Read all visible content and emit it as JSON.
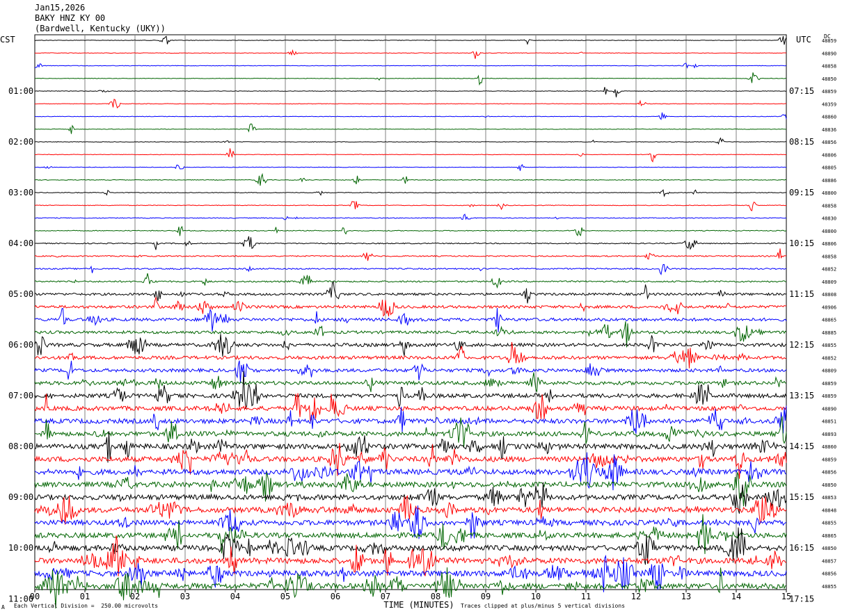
{
  "header": {
    "date": "Jan15,2026",
    "station": "BAKY HNZ KY 00",
    "location": "(Bardwell, Kentucky (UKY))"
  },
  "left_zone": "CST",
  "right_zone": "UTC",
  "dc_label": "DC",
  "footer": {
    "scale_note": "Each Vertical Division =  250.00 microvolts",
    "clip_note": "Traces clipped at plus/minus 5 vertical divisions",
    "corner_mark": "A"
  },
  "colors": {
    "trace_cycle": [
      "#000000",
      "#ff0000",
      "#0000ff",
      "#006400"
    ],
    "grid": "#808080"
  },
  "chart_data": {
    "type": "line",
    "title": "BAKY HNZ KY 00",
    "xlabel": "TIME (MINUTES)",
    "ylabel": "",
    "x_ticks": [
      "00",
      "01",
      "02",
      "03",
      "04",
      "05",
      "06",
      "07",
      "08",
      "09",
      "10",
      "11",
      "12",
      "13",
      "14",
      "15"
    ],
    "xlim": [
      0,
      15
    ],
    "left_hour_labels": [
      "01:00",
      "02:00",
      "03:00",
      "04:00",
      "05:00",
      "06:00",
      "07:00",
      "08:00",
      "09:00",
      "10:00",
      "11:00"
    ],
    "right_hour_labels": [
      "07:15",
      "08:15",
      "09:15",
      "10:15",
      "11:15",
      "12:15",
      "13:15",
      "14:15",
      "15:15",
      "16:15",
      "17:15"
    ],
    "dc_offsets": [
      "48859",
      "48890",
      "48858",
      "48850",
      "48859",
      "48359",
      "48860",
      "48836",
      "48856",
      "48806",
      "48805",
      "48886",
      "48800",
      "48858",
      "48830",
      "48800",
      "48806",
      "48858",
      "48852",
      "48809",
      "48808",
      "48906",
      "48865",
      "48885",
      "48855",
      "48852",
      "48809",
      "48859",
      "48859",
      "48890",
      "48851",
      "48893",
      "48860",
      "48859",
      "48856",
      "48850",
      "48853",
      "48848",
      "48855",
      "48865",
      "48850",
      "48857",
      "48856",
      "48855"
    ],
    "grid": true,
    "series": [
      {
        "values": [
          0.04,
          0.1
        ]
      },
      {
        "values": [
          0.04,
          0.1
        ]
      },
      {
        "values": [
          0.04,
          0.1
        ]
      },
      {
        "values": [
          0.04,
          0.1
        ]
      },
      {
        "values": [
          0.04,
          0.1
        ]
      },
      {
        "values": [
          0.04,
          0.1
        ]
      },
      {
        "values": [
          0.04,
          0.1
        ]
      },
      {
        "values": [
          0.04,
          0.1
        ]
      },
      {
        "values": [
          0.04,
          0.1
        ]
      },
      {
        "values": [
          0.04,
          0.1
        ]
      },
      {
        "values": [
          0.04,
          0.1
        ]
      },
      {
        "values": [
          0.05,
          0.1
        ]
      },
      {
        "values": [
          0.05,
          0.1
        ]
      },
      {
        "values": [
          0.05,
          0.1
        ]
      },
      {
        "values": [
          0.06,
          0.1
        ]
      },
      {
        "values": [
          0.06,
          0.1
        ]
      },
      {
        "values": [
          0.08,
          0.1
        ]
      },
      {
        "values": [
          0.09,
          0.1
        ]
      },
      {
        "values": [
          0.1,
          0.1
        ]
      },
      {
        "values": [
          0.12,
          0.1
        ]
      },
      {
        "values": [
          0.18,
          0.1
        ]
      },
      {
        "values": [
          0.22,
          0.1
        ]
      },
      {
        "values": [
          0.24,
          0.1
        ]
      },
      {
        "values": [
          0.22,
          0.1
        ]
      },
      {
        "values": [
          0.26,
          0.1
        ]
      },
      {
        "values": [
          0.26,
          0.1
        ]
      },
      {
        "values": [
          0.26,
          0.1
        ]
      },
      {
        "values": [
          0.28,
          0.1
        ]
      },
      {
        "values": [
          0.32,
          0.1
        ]
      },
      {
        "values": [
          0.34,
          0.1
        ]
      },
      {
        "values": [
          0.36,
          0.1
        ]
      },
      {
        "values": [
          0.36,
          0.1
        ]
      },
      {
        "values": [
          0.4,
          0.1
        ]
      },
      {
        "values": [
          0.4,
          0.1
        ]
      },
      {
        "values": [
          0.42,
          0.1
        ]
      },
      {
        "values": [
          0.4,
          0.1
        ]
      },
      {
        "values": [
          0.4,
          0.1
        ]
      },
      {
        "values": [
          0.42,
          0.1
        ]
      },
      {
        "values": [
          0.4,
          0.1
        ]
      },
      {
        "values": [
          0.4,
          0.1
        ]
      },
      {
        "values": [
          0.42,
          0.1
        ]
      },
      {
        "values": [
          0.44,
          0.1
        ]
      },
      {
        "values": [
          0.44,
          0.1
        ]
      },
      {
        "values": [
          0.44,
          0.1
        ]
      }
    ]
  }
}
